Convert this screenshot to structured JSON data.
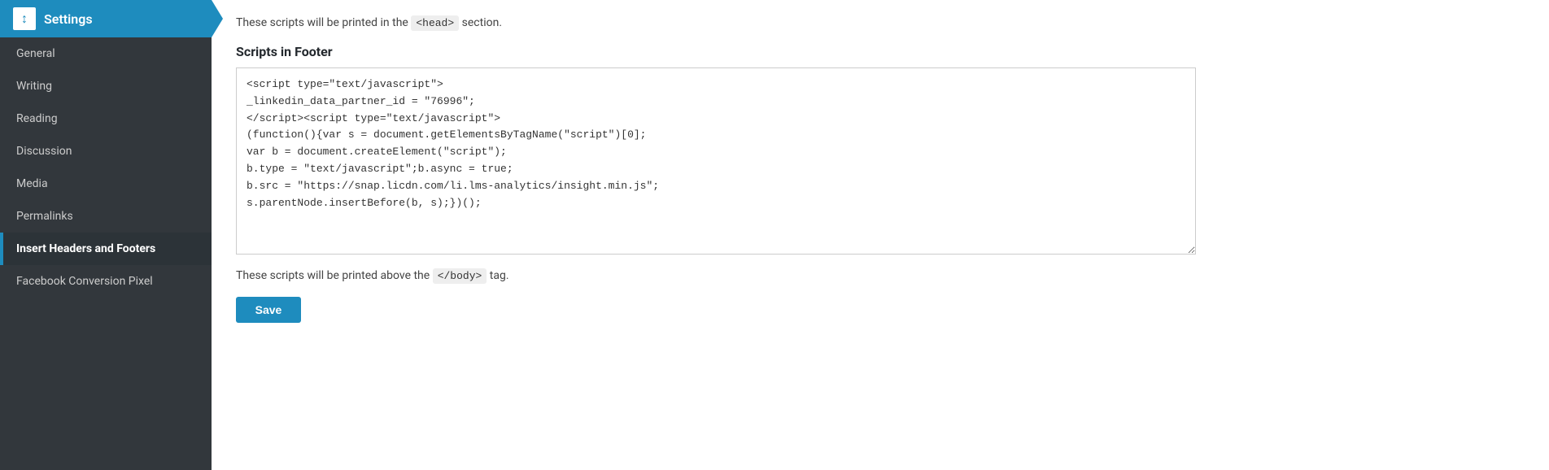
{
  "sidebar": {
    "header": {
      "icon": "↕",
      "title": "Settings"
    },
    "items": [
      {
        "label": "General",
        "active": false
      },
      {
        "label": "Writing",
        "active": false
      },
      {
        "label": "Reading",
        "active": false
      },
      {
        "label": "Discussion",
        "active": false
      },
      {
        "label": "Media",
        "active": false
      },
      {
        "label": "Permalinks",
        "active": false
      },
      {
        "label": "Insert Headers and Footers",
        "active": true
      },
      {
        "label": "Facebook Conversion Pixel",
        "active": false
      }
    ]
  },
  "main": {
    "head_text": "These scripts will be printed in the",
    "head_code": "<head>",
    "head_suffix": "section.",
    "section_title": "Scripts in Footer",
    "footer_code": "<script type=\"text/javascript\">\n_linkedin_data_partner_id = \"76996\";\n</script><script type=\"text/javascript\">\n(function(){var s = document.getElementsByTagName(\"script\")[0];\nvar b = document.createElement(\"script\");\nb.type = \"text/javascript\";b.async = true;\nb.src = \"https://snap.licdn.com/li.lms-analytics/insight.min.js\";\ns.parentNode.insertBefore(b, s);})();\n",
    "body_text": "These scripts will be printed above the",
    "body_code": "</body>",
    "body_suffix": "tag.",
    "save_label": "Save"
  }
}
